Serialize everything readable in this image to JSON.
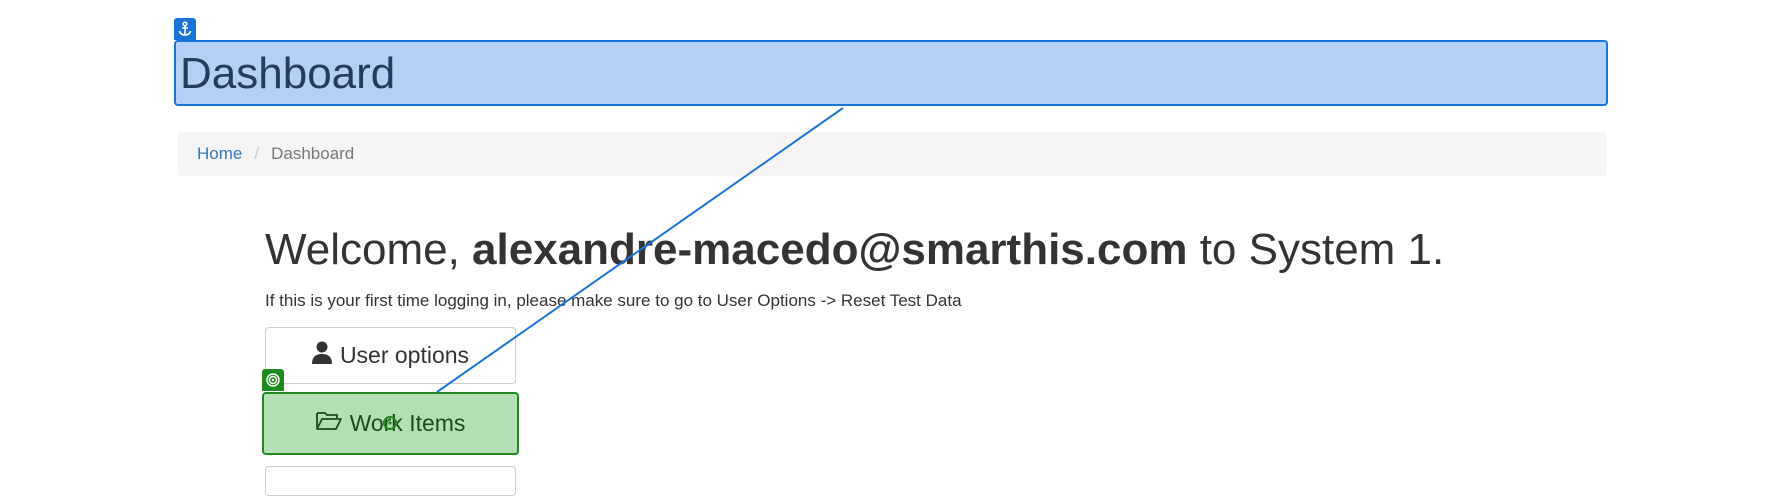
{
  "header": {
    "title": "Dashboard"
  },
  "breadcrumb": {
    "home": "Home",
    "separator": "/",
    "current": "Dashboard"
  },
  "welcome": {
    "prefix": "Welcome,",
    "email": "alexandre-macedo@smarthis.com",
    "suffix": "to System 1."
  },
  "hint": "If this is your first time logging in, please make sure to go to User Options -> Reset Test Data",
  "buttons": {
    "user_options": "User options",
    "work_items": "Work Items"
  },
  "icons": {
    "anchor": "anchor-icon",
    "target": "target-icon",
    "user": "user-icon",
    "folder": "folder-open-icon",
    "crosshair": "crosshair-icon"
  },
  "colors": {
    "annotation_blue": "#1a73d9",
    "annotation_green": "#1f8a1f",
    "link": "#337ab7"
  }
}
